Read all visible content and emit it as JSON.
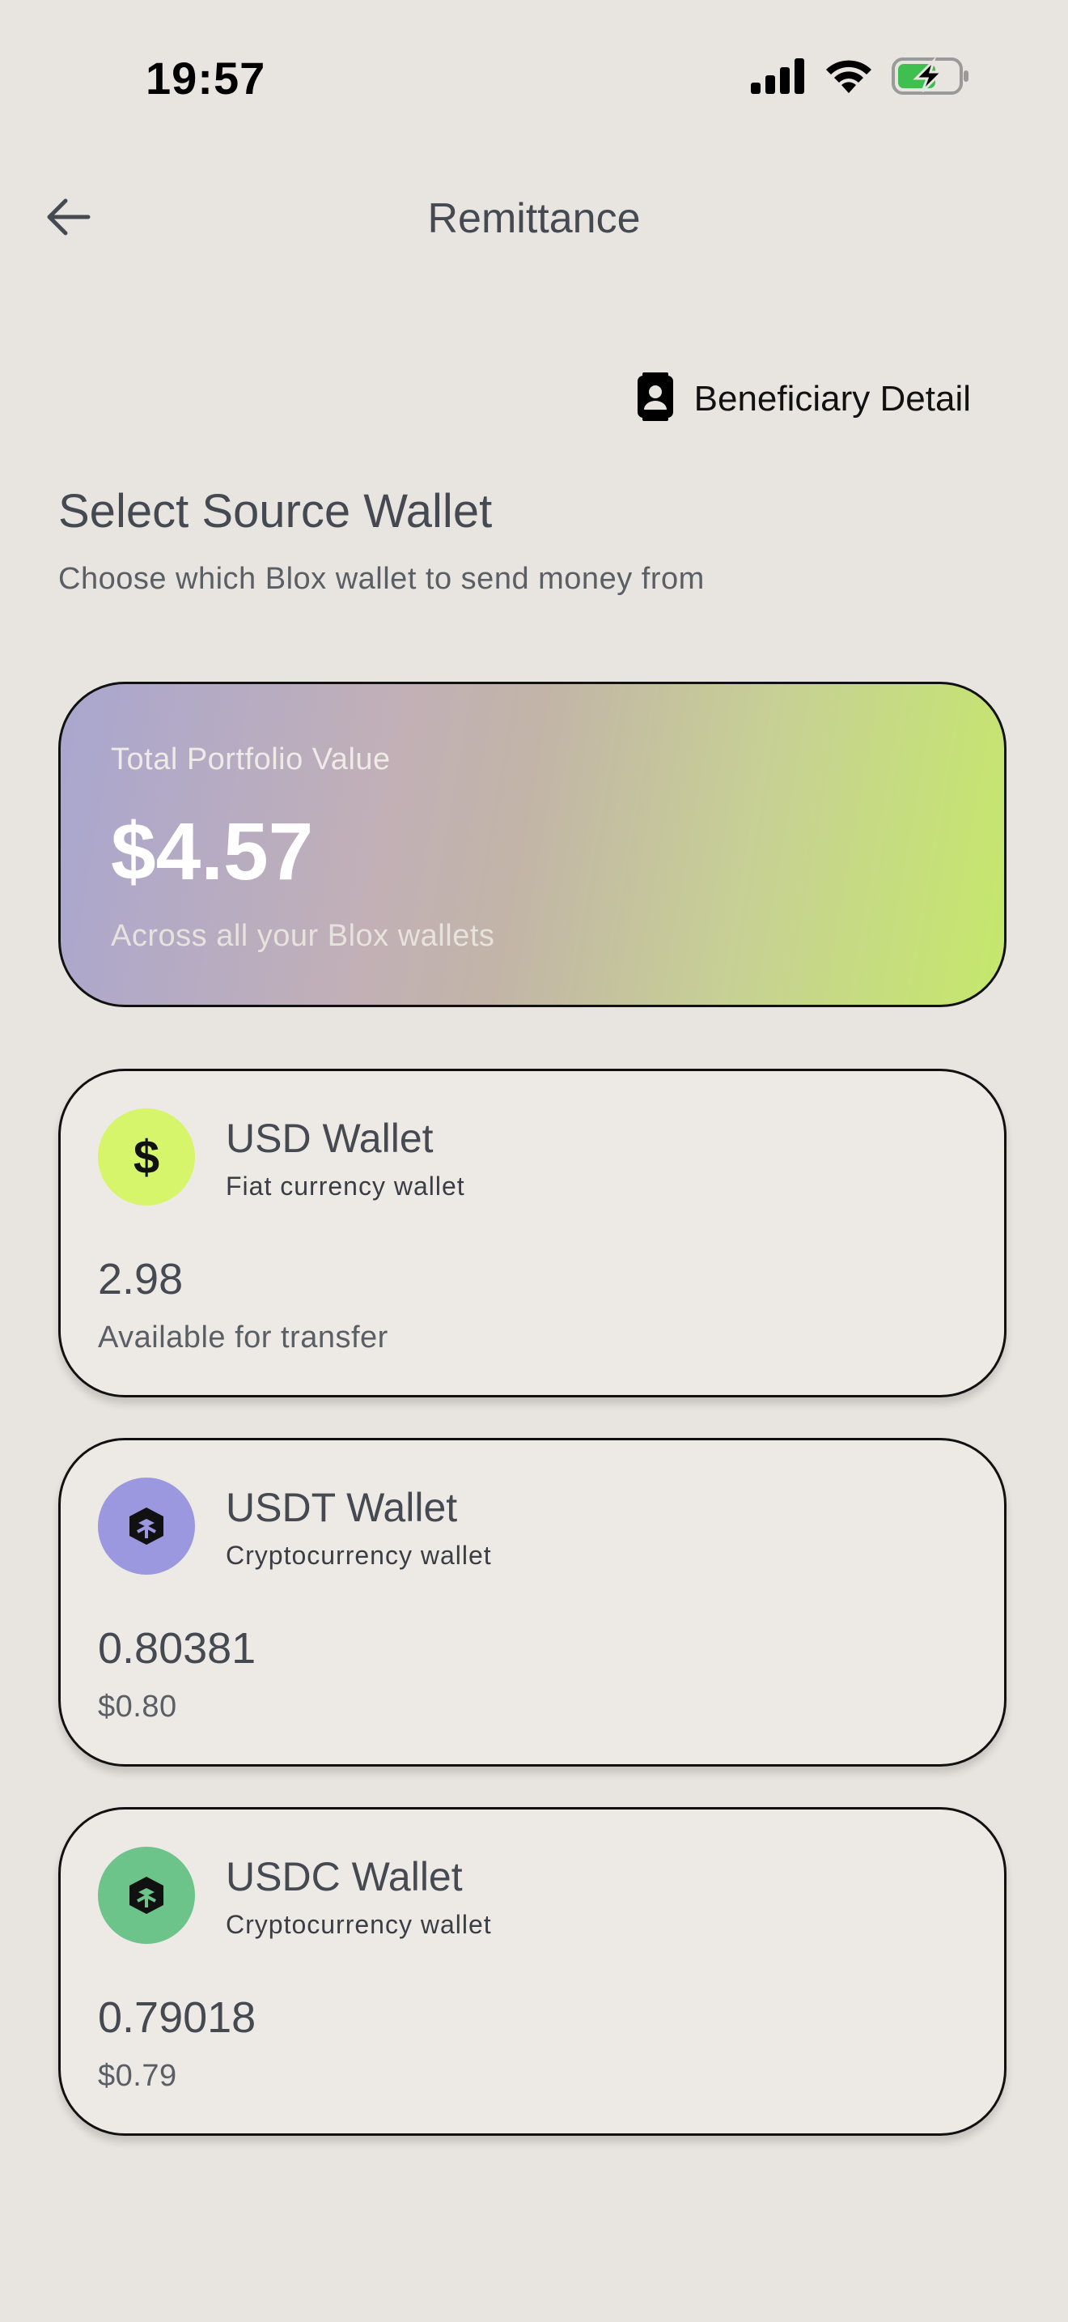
{
  "status_bar": {
    "time": "19:57"
  },
  "nav": {
    "title": "Remittance",
    "back_icon": "arrow-left-icon"
  },
  "beneficiary": {
    "label": "Beneficiary Detail",
    "icon": "contact-card-icon"
  },
  "section": {
    "title": "Select Source Wallet",
    "subtitle": "Choose which Blox wallet to send money from"
  },
  "portfolio": {
    "label": "Total Portfolio Value",
    "value": "$4.57",
    "note": "Across all your Blox wallets"
  },
  "wallets": [
    {
      "name": "USD Wallet",
      "type": "Fiat currency wallet",
      "balance": "2.98",
      "caption": "Available for transfer",
      "icon": "dollar-icon",
      "icon_bg": "#d6f56b"
    },
    {
      "name": "USDT Wallet",
      "type": "Cryptocurrency wallet",
      "balance": "0.80381",
      "caption": "$0.80",
      "icon": "cube-icon",
      "icon_bg": "#9b98e0"
    },
    {
      "name": "USDC Wallet",
      "type": "Cryptocurrency wallet",
      "balance": "0.79018",
      "caption": "$0.79",
      "icon": "cube-icon",
      "icon_bg": "#6cc48a"
    }
  ],
  "colors": {
    "background": "#e8e5e0",
    "card": "#edeae5",
    "text": "#454a52",
    "battery_fill": "#3fbf4f"
  }
}
